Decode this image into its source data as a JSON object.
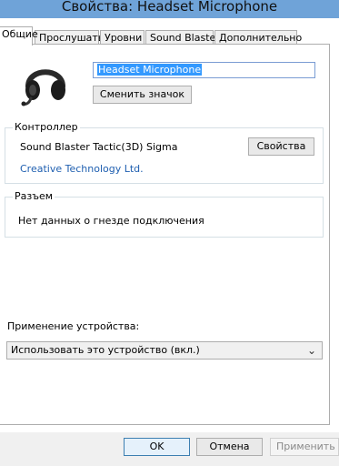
{
  "window": {
    "title": "Свойства: Headset Microphone"
  },
  "tabs": [
    {
      "label": "Общие"
    },
    {
      "label": "Прослушать"
    },
    {
      "label": "Уровни"
    },
    {
      "label": "Sound Blaster"
    },
    {
      "label": "Дополнительно"
    }
  ],
  "device": {
    "name_value": "Headset Microphone",
    "icon": "headset-icon",
    "change_icon_label": "Сменить значок"
  },
  "controller": {
    "group_label": "Контроллер",
    "name": "Sound Blaster Tactic(3D) Sigma",
    "vendor": "Creative Technology Ltd.",
    "properties_label": "Свойства"
  },
  "jack": {
    "group_label": "Разъем",
    "info": "Нет данных о гнезде подключения"
  },
  "usage": {
    "label": "Применение устройства:",
    "selected": "Использовать это устройство (вкл.)"
  },
  "buttons": {
    "ok": "OK",
    "cancel": "Отмена",
    "apply": "Применить"
  }
}
